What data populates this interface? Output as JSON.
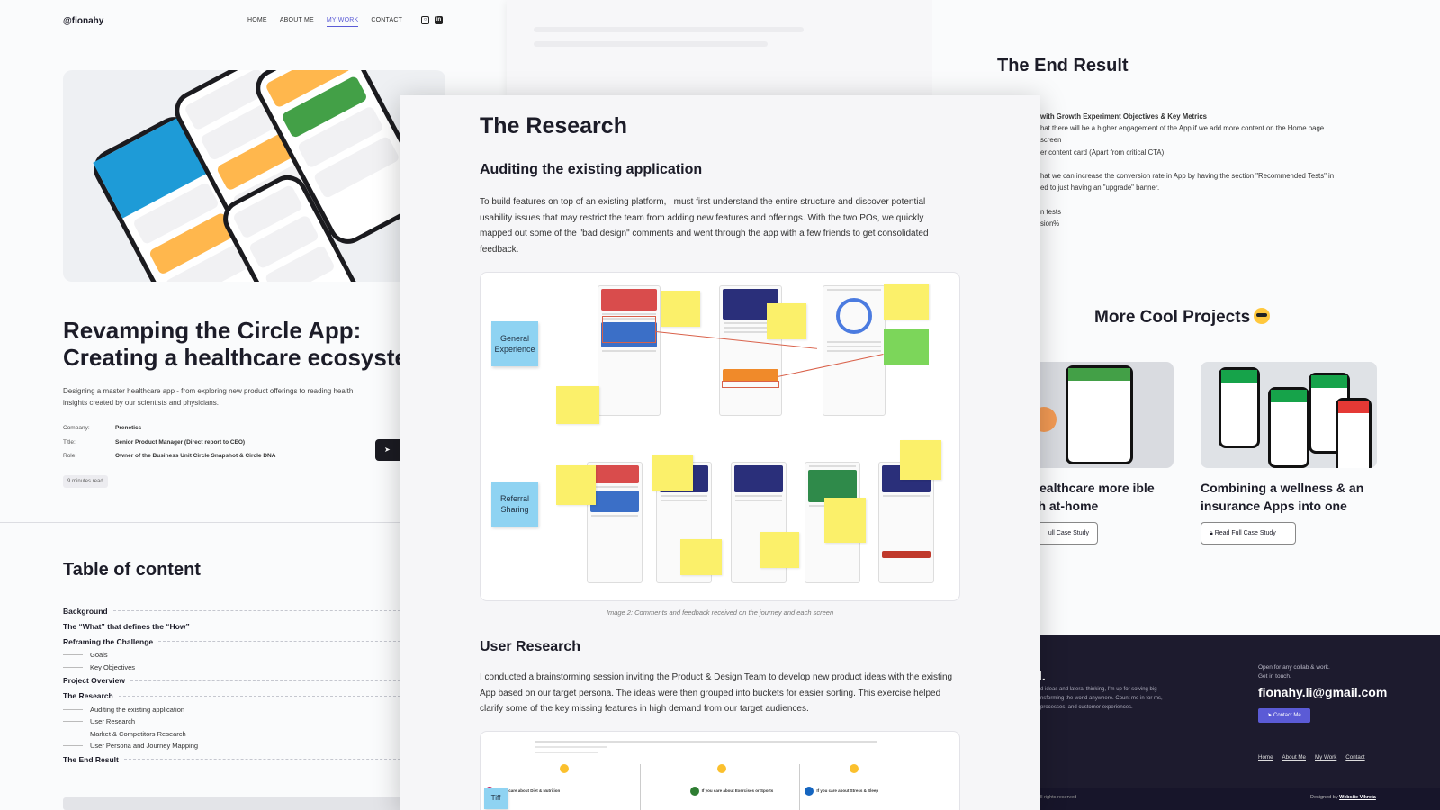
{
  "left": {
    "logo": "@fionahy",
    "nav": [
      "HOME",
      "ABOUT ME",
      "MY WORK",
      "CONTACT"
    ],
    "active_nav": "MY WORK",
    "title_line1": "Revamping the Circle App:",
    "title_line2": "Creating a healthcare ecosyste",
    "description": "Designing a master healthcare app - from exploring new product offerings to reading health insights created by our scientists and physicians.",
    "meta": [
      {
        "k": "Company:",
        "v": "Prenetics"
      },
      {
        "k": "Title:",
        "v": "Senior Product Manager (Direct report to CEO)"
      },
      {
        "k": "Role:",
        "v": "Owner of the Business Unit Circle Snapshot & Circle DNA"
      }
    ],
    "read_time": "9 minutes read",
    "toc_title": "Table of content",
    "toc": [
      {
        "label": "Background",
        "level": 1
      },
      {
        "label": "The “What” that defines the “How”",
        "level": 1
      },
      {
        "label": "Reframing the Challenge",
        "level": 1
      },
      {
        "label": "Goals",
        "level": 2
      },
      {
        "label": "Key Objectives",
        "level": 2
      },
      {
        "label": "Project Overview",
        "level": 1
      },
      {
        "label": "The Research",
        "level": 1
      },
      {
        "label": "Auditing the existing application",
        "level": 2
      },
      {
        "label": "User Research",
        "level": 2
      },
      {
        "label": "Market & Competitors Research",
        "level": 2
      },
      {
        "label": "User Persona and Journey Mapping",
        "level": 2
      },
      {
        "label": "The End Result",
        "level": 1
      }
    ]
  },
  "center": {
    "h1": "The Research",
    "h2": "Auditing the existing application",
    "p1": "To build features on top of an existing platform, I must first understand the entire structure and discover potential usability issues that may restrict the team from adding new features and offerings. With the two POs, we quickly mapped out some of the \"bad design\" comments and went through the app with a few friends to get consolidated feedback.",
    "sticky1": "General Experience",
    "sticky2": "Referral Sharing",
    "caption": "Image 2: Comments and feedback received on the journey and each screen",
    "h3": "User Research",
    "p2": "I conducted a brainstorming session inviting the Product & Design Team to develop new product ideas with the existing App based on our target persona. The ideas were then grouped into buckets for easier sorting. This exercise helped clarify some of the key missing features in high demand from our target audiences.",
    "bs_sticky": "Tiff",
    "bs_cols": [
      "If you care about Diet & Nutrition",
      "If you care about Exercises or Sports",
      "If you care about Stress & Sleep"
    ]
  },
  "right": {
    "end_title": "The End Result",
    "end_lines": [
      "with Growth Experiment Objectives & Key Metrics",
      "hat there will be a higher engagement of the App if we add more content on the Home page.",
      "screen",
      "er content card (Apart from critical CTA)",
      "",
      "hat we can increase the conversion rate in App by having the section \"Recommended Tests\" in",
      "ed to just having an \"upgrade\" banner.",
      "",
      "n tests",
      "sion%"
    ],
    "more_title": "More Cool Projects",
    "proj1_title": "g healthcare more ible with at-home",
    "proj2_title": "Combining a wellness & an insurance Apps into one",
    "proj1_btn": "ull Case Study",
    "proj2_btn": "Read Full Case Study",
    "footer_name": "l.",
    "footer_copy": "d ideas and lateral thinking, I'm up for solving big nsforming the world anywhere. Count me in for ms, processes, and customer experiences.",
    "footer_open": "Open for any collab & work.",
    "footer_touch": "Get in touch.",
    "email": "fionahy.li@gmail.com",
    "contact_btn": "Contact Me",
    "footer_links": [
      "Home",
      "About Me",
      "My Work",
      "Contact"
    ],
    "rights": "ll rights reserved",
    "designed_by": "Designed by",
    "designer": "Website Vikreta"
  },
  "colors": {
    "accent": "#5b5bd6",
    "footer_bg": "#1d1b2e"
  }
}
